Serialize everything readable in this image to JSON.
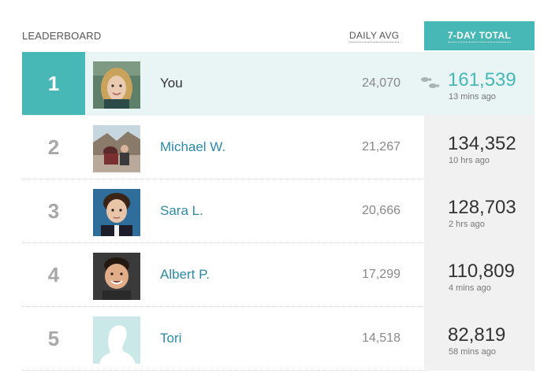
{
  "header": {
    "title": "LEADERBOARD",
    "daily_label": "DAILY AVG",
    "total_label": "7-DAY TOTAL"
  },
  "colors": {
    "accent": "#47b8b5",
    "highlight_bg": "#e9f4f4",
    "link": "#2c8aa6"
  },
  "rows": [
    {
      "rank": "1",
      "name": "You",
      "daily": "24,070",
      "total": "161,539",
      "ago": "13 mins ago",
      "avatar": "avatar-photo-woman",
      "icon": "footsteps-icon"
    },
    {
      "rank": "2",
      "name": "Michael W.",
      "daily": "21,267",
      "total": "134,352",
      "ago": "10 hrs ago",
      "avatar": "avatar-photo-outdoors"
    },
    {
      "rank": "3",
      "name": "Sara L.",
      "daily": "20,666",
      "total": "128,703",
      "ago": "2 hrs ago",
      "avatar": "avatar-photo-boy"
    },
    {
      "rank": "4",
      "name": "Albert P.",
      "daily": "17,299",
      "total": "110,809",
      "ago": "4 mins ago",
      "avatar": "avatar-photo-man"
    },
    {
      "rank": "5",
      "name": "Tori",
      "daily": "14,518",
      "total": "82,819",
      "ago": "58 mins ago",
      "avatar": "default-avatar-silhouette"
    }
  ]
}
